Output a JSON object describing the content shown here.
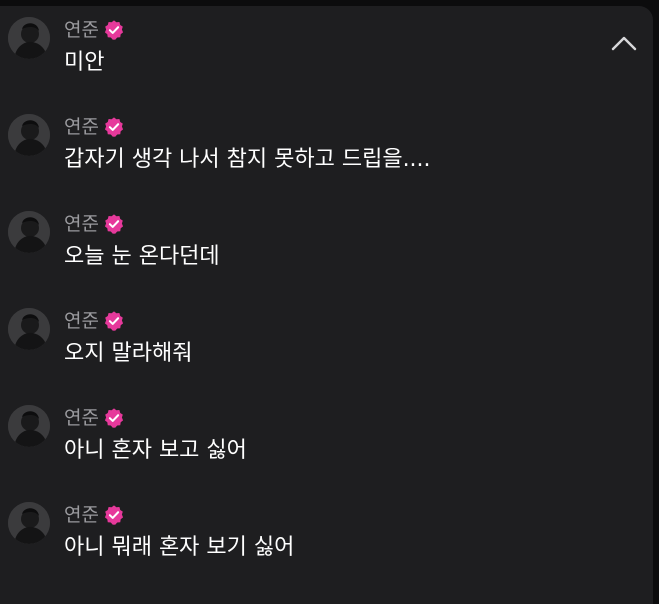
{
  "chat": {
    "accent_color": "#e6399b",
    "messages": [
      {
        "author": "연준",
        "verified": true,
        "text": "미안"
      },
      {
        "author": "연준",
        "verified": true,
        "text": "갑자기 생각 나서 참지 못하고 드립을...."
      },
      {
        "author": "연준",
        "verified": true,
        "text": "오늘 눈 온다던데"
      },
      {
        "author": "연준",
        "verified": true,
        "text": "오지 말라해줘"
      },
      {
        "author": "연준",
        "verified": true,
        "text": "아니 혼자 보고 싫어"
      },
      {
        "author": "연준",
        "verified": true,
        "text": "아니 뭐래 혼자 보기 싫어"
      }
    ]
  },
  "controls": {
    "collapse_icon": "chevron-up-icon"
  }
}
